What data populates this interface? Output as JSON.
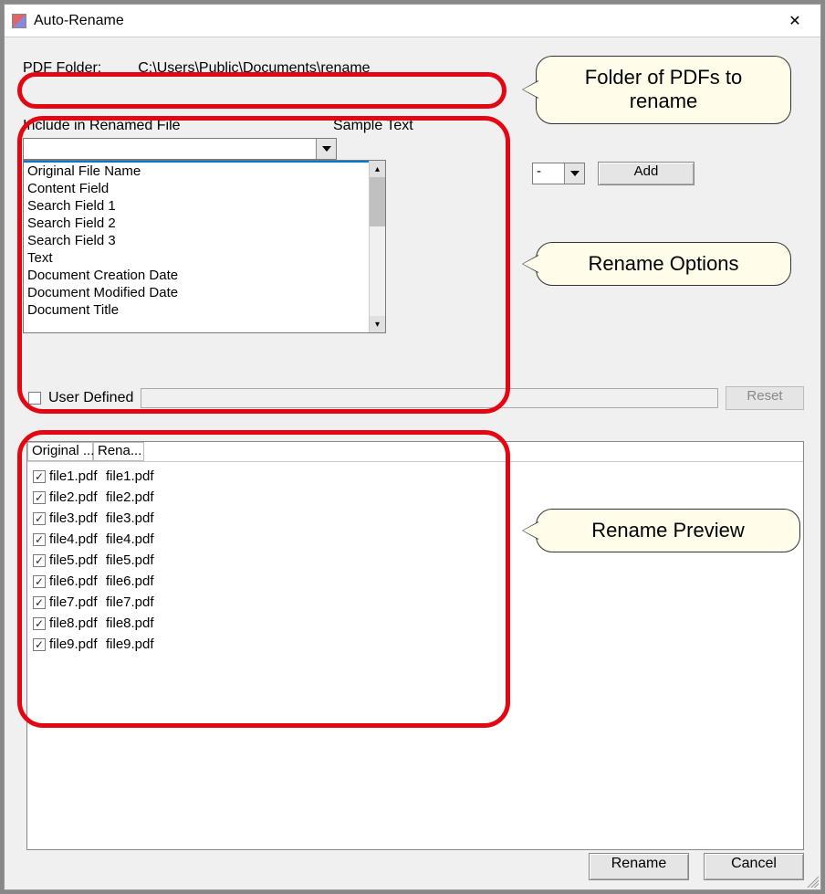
{
  "window": {
    "title": "Auto-Rename"
  },
  "folder": {
    "label": "PDF Folder:",
    "path": "C:\\Users\\Public\\Documents\\rename"
  },
  "include": {
    "label": "Include in Renamed File",
    "sample_label": "Sample Text",
    "options": [
      "",
      "Original File Name",
      "Content Field",
      "Search Field 1",
      "Search Field 2",
      "Search Field 3",
      "Text",
      "Document Creation Date",
      "Document Modified Date",
      "Document Title"
    ]
  },
  "separator": {
    "value": "-",
    "add_label": "Add"
  },
  "userdef": {
    "label": "User Defined",
    "checked": false,
    "value": "",
    "reset_label": "Reset"
  },
  "preview": {
    "columns": [
      "Original ...",
      "Rena..."
    ],
    "rows": [
      {
        "checked": true,
        "original": "file1.pdf",
        "renamed": "file1.pdf"
      },
      {
        "checked": true,
        "original": "file2.pdf",
        "renamed": "file2.pdf"
      },
      {
        "checked": true,
        "original": "file3.pdf",
        "renamed": "file3.pdf"
      },
      {
        "checked": true,
        "original": "file4.pdf",
        "renamed": "file4.pdf"
      },
      {
        "checked": true,
        "original": "file5.pdf",
        "renamed": "file5.pdf"
      },
      {
        "checked": true,
        "original": "file6.pdf",
        "renamed": "file6.pdf"
      },
      {
        "checked": true,
        "original": "file7.pdf",
        "renamed": "file7.pdf"
      },
      {
        "checked": true,
        "original": "file8.pdf",
        "renamed": "file8.pdf"
      },
      {
        "checked": true,
        "original": "file9.pdf",
        "renamed": "file9.pdf"
      }
    ]
  },
  "buttons": {
    "rename": "Rename",
    "cancel": "Cancel"
  },
  "callouts": {
    "folder": "Folder of PDFs to rename",
    "options": "Rename Options",
    "preview": "Rename Preview"
  }
}
